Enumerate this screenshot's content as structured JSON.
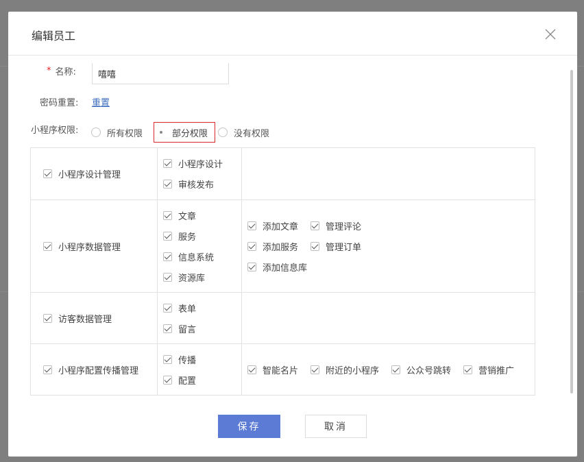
{
  "dialog": {
    "title": "编辑员工"
  },
  "form": {
    "name_label": "名称:",
    "required_mark": "*",
    "name_value": "嘻嘻",
    "password_label": "密码重置:",
    "password_link": "重置",
    "permission_label": "小程序权限:",
    "permission_options": [
      "所有权限",
      "部分权限",
      "没有权限"
    ],
    "permission_selected": "部分权限"
  },
  "permissions": [
    {
      "group": "小程序设计管理",
      "items": [
        "小程序设计",
        "审核发布"
      ],
      "sub_items": []
    },
    {
      "group": "小程序数据管理",
      "items": [
        "文章",
        "服务",
        "信息系统",
        "资源库"
      ],
      "sub_items": [
        "添加文章",
        "管理评论",
        "添加服务",
        "管理订单",
        "添加信息库"
      ]
    },
    {
      "group": "访客数据管理",
      "items": [
        "表单",
        "留言"
      ],
      "sub_items": []
    },
    {
      "group": "小程序配置传播管理",
      "items": [
        "传播",
        "配置"
      ],
      "sub_items": [
        "智能名片",
        "附近的小程序",
        "公众号跳转",
        "营销推广"
      ]
    }
  ],
  "buttons": {
    "save": "保存",
    "cancel": "取消"
  },
  "colors": {
    "primary": "#5b7bd5",
    "link": "#3f6fbf",
    "highlight_border": "#d9272e",
    "required": "#e02020"
  }
}
